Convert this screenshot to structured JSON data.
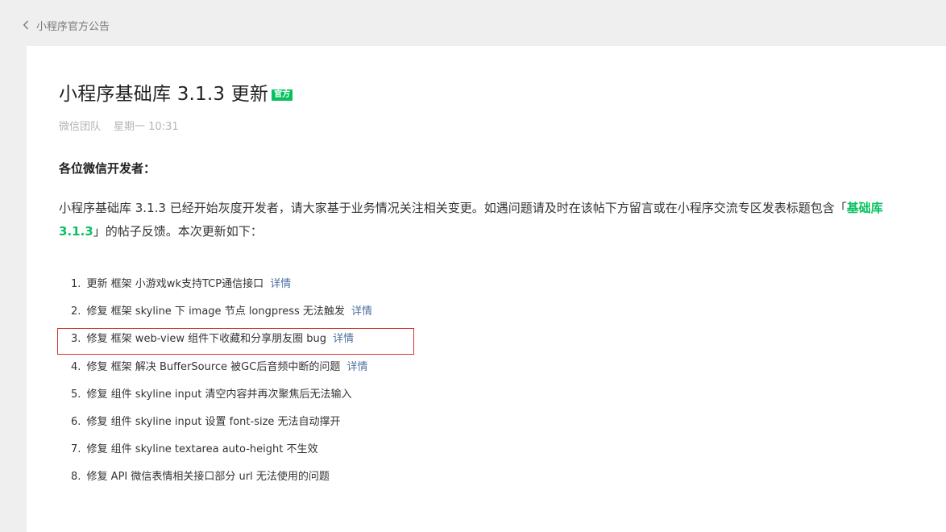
{
  "nav": {
    "back_label": "小程序官方公告"
  },
  "article": {
    "title": "小程序基础库 3.1.3 更新",
    "badge": "官方",
    "author": "微信团队",
    "date": "星期一 10:31",
    "greeting": "各位微信开发者：",
    "intro_before": "小程序基础库 3.1.3 已经开始灰度开发者，请大家基于业务情况关注相关变更。如遇问题请及时在该帖下方留言或在小程序交流专区发表标题包含「",
    "intro_keyword": "基础库3.1.3",
    "intro_after": "」的帖子反馈。本次更新如下：",
    "items": [
      {
        "num": "1.",
        "text": "更新 框架 小游戏wk支持TCP通信接口",
        "link": "详情"
      },
      {
        "num": "2.",
        "text": "修复 框架 skyline 下 image 节点 longpress 无法触发",
        "link": "详情"
      },
      {
        "num": "3.",
        "text": "修复 框架 web-view 组件下收藏和分享朋友圈 bug",
        "link": "详情"
      },
      {
        "num": "4.",
        "text": "修复 框架 解决 BufferSource 被GC后音频中断的问题",
        "link": "详情"
      },
      {
        "num": "5.",
        "text": "修复 组件 skyline input 清空内容并再次聚焦后无法输入",
        "link": ""
      },
      {
        "num": "6.",
        "text": "修复 组件 skyline input 设置 font-size 无法自动撑开",
        "link": ""
      },
      {
        "num": "7.",
        "text": "修复 组件 skyline textarea auto-height 不生效",
        "link": ""
      },
      {
        "num": "8.",
        "text": "修复 API 微信表情相关接口部分 url 无法使用的问题",
        "link": ""
      }
    ]
  },
  "colors": {
    "accent_green": "#07c160",
    "link_blue": "#4e6fa0",
    "highlight_red": "#d9332f"
  },
  "icons": {
    "back": "chevron-left-icon"
  }
}
